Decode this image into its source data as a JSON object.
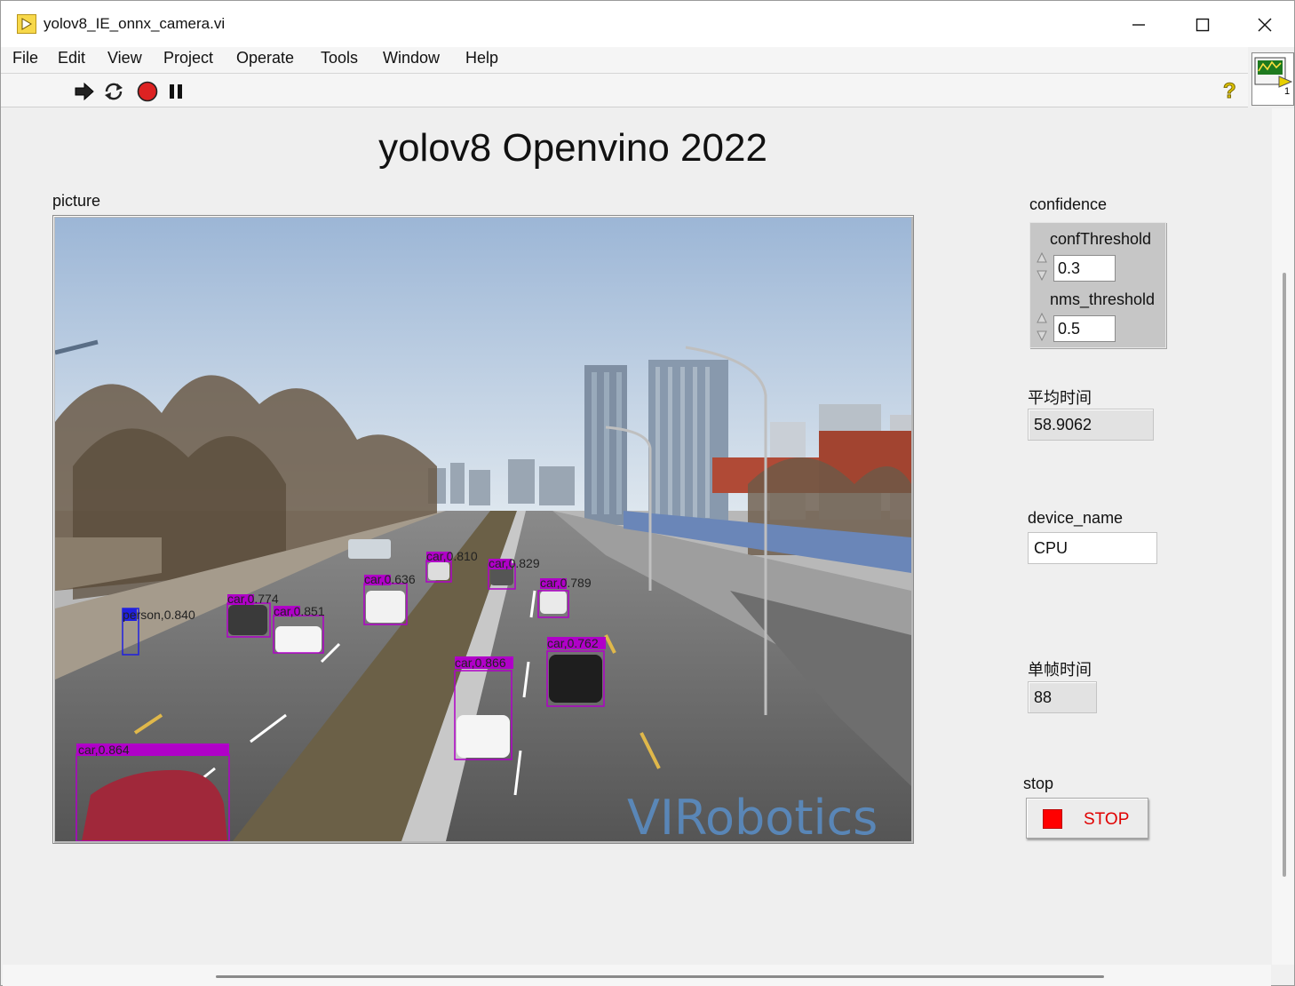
{
  "window": {
    "title": "yolov8_IE_onnx_camera.vi"
  },
  "menu": {
    "items": [
      "File",
      "Edit",
      "View",
      "Project",
      "Operate",
      "Tools",
      "Window",
      "Help"
    ]
  },
  "toolbar": {
    "icons": [
      "run-arrow-icon",
      "run-continuously-icon",
      "abort-execution-icon",
      "pause-icon",
      "help-icon"
    ]
  },
  "connector": {
    "index": "1"
  },
  "panel": {
    "title": "yolov8 Openvino 2022",
    "picture_label": "picture",
    "confidence_label": "confidence",
    "conf_threshold_label": "confThreshold",
    "conf_threshold_value": "0.3",
    "nms_threshold_label": "nms_threshold",
    "nms_threshold_value": "0.5",
    "avg_time_label": "平均时间",
    "avg_time_value": "58.9062",
    "device_name_label": "device_name",
    "device_name_value": "CPU",
    "frame_time_label": "单帧时间",
    "frame_time_value": "88",
    "stop_label": "stop",
    "stop_button_text": "STOP"
  },
  "image": {
    "watermark": "VIRobotics",
    "detections": [
      {
        "label": "person,0.840"
      },
      {
        "label": "car,0.774"
      },
      {
        "label": "car,0.851"
      },
      {
        "label": "car,0.636"
      },
      {
        "label": "car,0.810"
      },
      {
        "label": "car,0.829"
      },
      {
        "label": "car,0.789"
      },
      {
        "label": "car,0.866"
      },
      {
        "label": "car,0.762"
      },
      {
        "label": "car,0.864"
      }
    ],
    "colors": {
      "car_box": "#b000c8",
      "person_box": "#2020e0"
    }
  }
}
